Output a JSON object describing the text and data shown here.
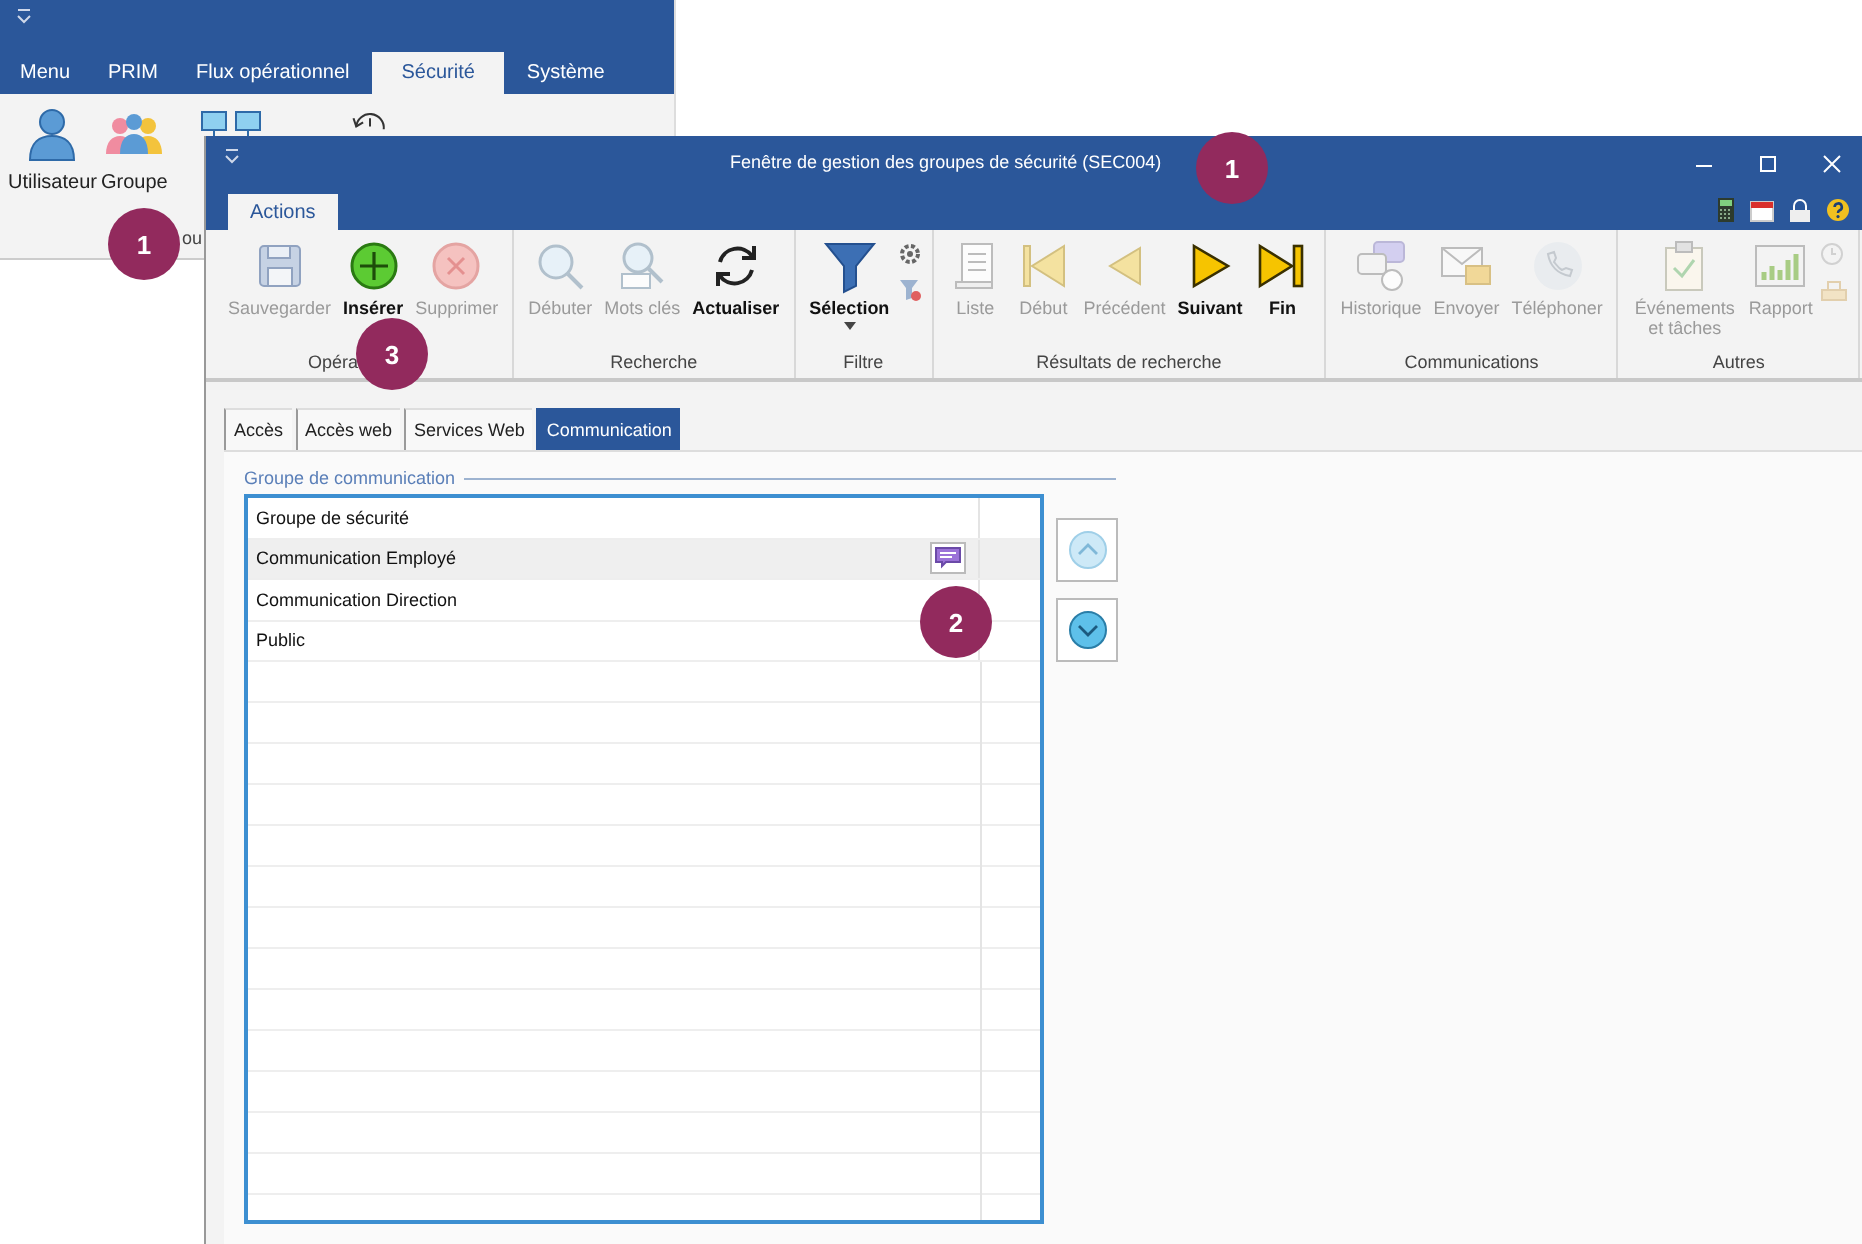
{
  "back_app": {
    "tabs": [
      {
        "label": "Menu",
        "selected": false
      },
      {
        "label": "PRIM",
        "selected": false
      },
      {
        "label": "Flux opérationnel",
        "selected": false
      },
      {
        "label": "Sécurité",
        "selected": true
      },
      {
        "label": "Système",
        "selected": false
      }
    ],
    "buttons": [
      {
        "label": "Utilisateur"
      },
      {
        "label": "Groupe"
      }
    ],
    "group_label": "ou"
  },
  "window": {
    "title": "Fenêtre de gestion des groupes de sécurité (SEC004)",
    "tabs": [
      {
        "label": "Actions",
        "selected": true
      }
    ],
    "ribbon": [
      {
        "label": "Opéra",
        "buttons": [
          {
            "label": "Sauvegarder",
            "kind": "large",
            "enabled": false
          },
          {
            "label": "Insérer",
            "kind": "large",
            "enabled": true
          },
          {
            "label": "Supprimer",
            "kind": "large",
            "enabled": false
          }
        ]
      },
      {
        "label": "Recherche",
        "buttons": [
          {
            "label": "Débuter",
            "kind": "large",
            "enabled": false
          },
          {
            "label": "Mots clés",
            "kind": "large",
            "enabled": false
          },
          {
            "label": "Actualiser",
            "kind": "large",
            "enabled": true
          }
        ]
      },
      {
        "label": "Filtre",
        "buttons": [
          {
            "label": "Sélection",
            "kind": "dropdown",
            "enabled": true
          },
          {
            "kind": "small",
            "enabled": true
          }
        ]
      },
      {
        "label": "Résultats de recherche",
        "buttons": [
          {
            "label": "Liste",
            "kind": "large",
            "enabled": false
          },
          {
            "label": "Début",
            "kind": "large",
            "enabled": false
          },
          {
            "label": "Précédent",
            "kind": "large",
            "enabled": false
          },
          {
            "label": "Suivant",
            "kind": "large",
            "enabled": true
          },
          {
            "label": "Fin",
            "kind": "large",
            "enabled": true
          }
        ]
      },
      {
        "label": "Communications",
        "buttons": [
          {
            "label": "Historique",
            "kind": "large",
            "enabled": false
          },
          {
            "label": "Envoyer",
            "kind": "large",
            "enabled": false
          },
          {
            "label": "Téléphoner",
            "kind": "large",
            "enabled": false
          }
        ]
      },
      {
        "label": "Autres",
        "buttons": [
          {
            "label": "Événements et tâches",
            "kind": "large",
            "enabled": false
          },
          {
            "label": "Rapport",
            "kind": "large",
            "enabled": false
          },
          {
            "kind": "small",
            "enabled": false
          }
        ]
      }
    ],
    "content_tabs": [
      {
        "label": "Accès",
        "selected": false
      },
      {
        "label": "Accès web",
        "selected": false
      },
      {
        "label": "Services Web",
        "selected": false
      },
      {
        "label": "Communication",
        "selected": true
      }
    ],
    "group_title": "Groupe de communication",
    "rows": [
      {
        "name": "Groupe de sécurité",
        "selected": false
      },
      {
        "name": "Communication Employé",
        "selected": true
      },
      {
        "name": "Communication Direction",
        "selected": false
      },
      {
        "name": "Public",
        "selected": false
      }
    ]
  },
  "callouts": [
    {
      "number": "1"
    },
    {
      "number": "1"
    },
    {
      "number": "2"
    },
    {
      "number": "3"
    }
  ]
}
